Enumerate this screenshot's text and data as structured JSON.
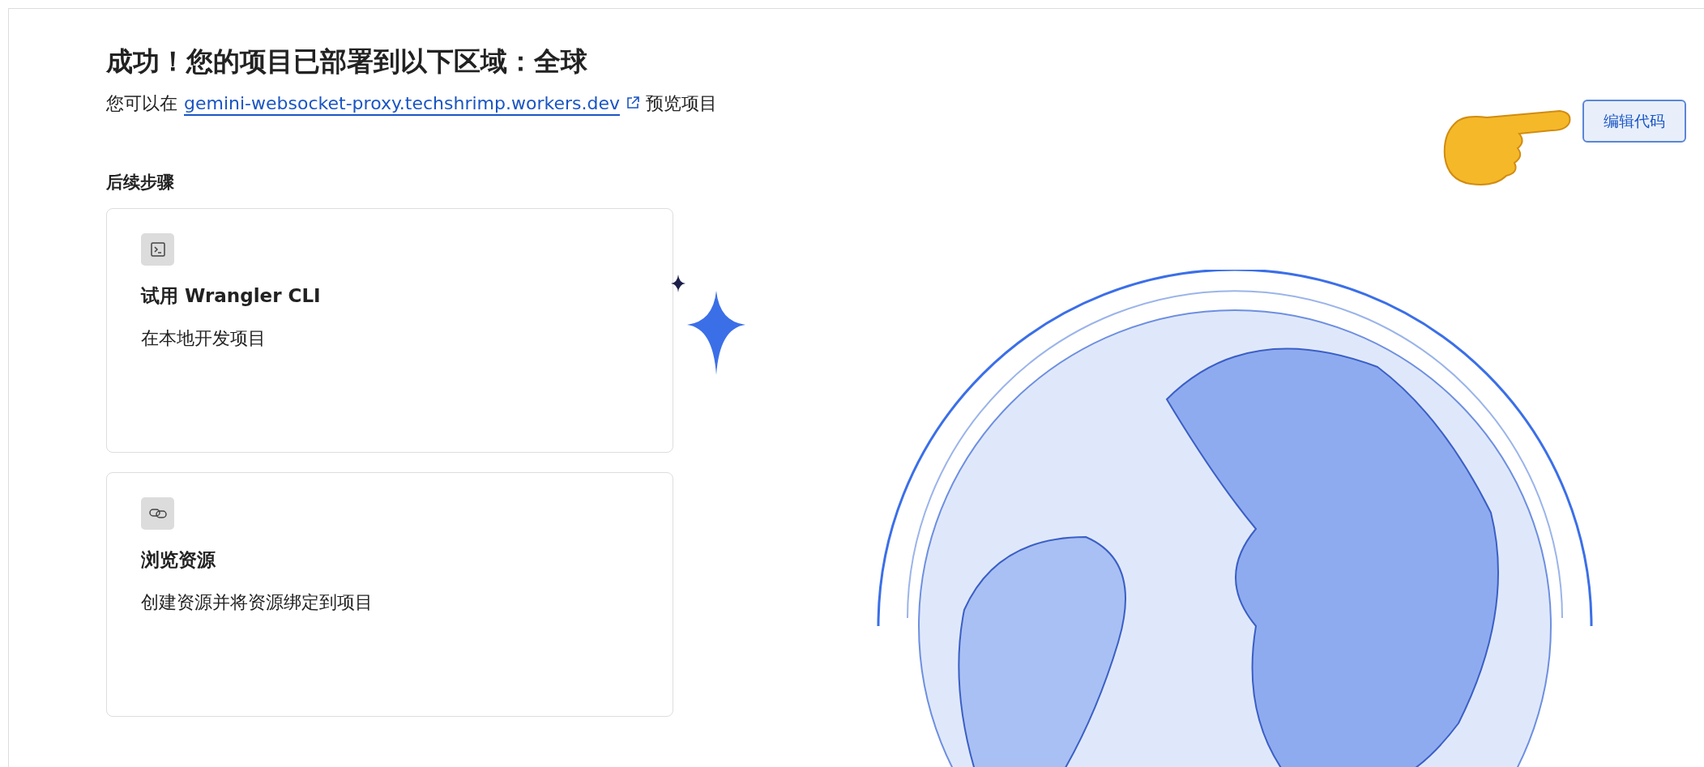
{
  "page": {
    "title": "成功！您的项目已部署到以下区域：全球",
    "preview": {
      "prefix": "您可以在",
      "link": "gemini-websocket-proxy.techshrimp.workers.dev",
      "suffix": "预览项目"
    },
    "edit_button": "编辑代码"
  },
  "next_steps": {
    "heading": "后续步骤",
    "cards": [
      {
        "kind": "terminal",
        "title": "试用 Wrangler CLI",
        "description": "在本地开发项目"
      },
      {
        "kind": "link",
        "title": "浏览资源",
        "description": "创建资源并将资源绑定到项目"
      }
    ]
  }
}
